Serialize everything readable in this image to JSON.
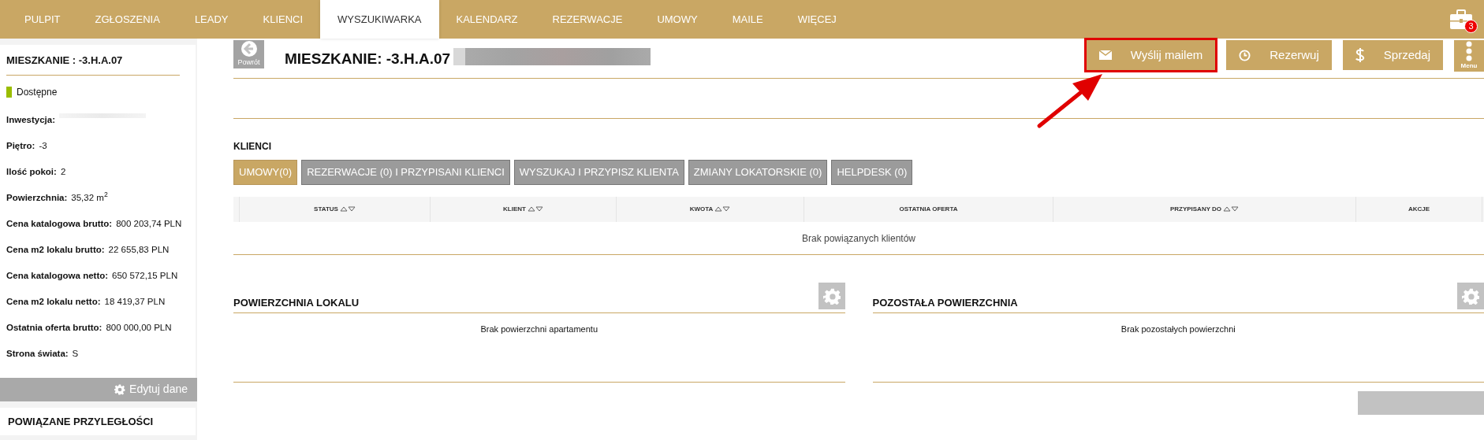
{
  "nav": {
    "items": [
      {
        "label": "PULPIT",
        "selected": false
      },
      {
        "label": "ZGŁOSZENIA",
        "selected": false
      },
      {
        "label": "LEADY",
        "selected": false
      },
      {
        "label": "KLIENCI",
        "selected": false
      },
      {
        "label": "WYSZUKIWARKA",
        "selected": true
      },
      {
        "label": "KALENDARZ",
        "selected": false
      },
      {
        "label": "REZERWACJE",
        "selected": false
      },
      {
        "label": "UMOWY",
        "selected": false
      },
      {
        "label": "MAILE",
        "selected": false
      },
      {
        "label": "WIĘCEJ",
        "selected": false
      }
    ],
    "notifications": "3"
  },
  "sidebar": {
    "title": "MIESZKANIE : -3.H.A.07",
    "status": {
      "label": "Dostępne",
      "color": "#9abd00"
    },
    "fields": [
      {
        "kind": "redacted",
        "label": "Inwestycja:"
      },
      {
        "kind": "text",
        "label": "Piętro:",
        "value": "-3"
      },
      {
        "kind": "text",
        "label": "Ilość pokoi:",
        "value": "2"
      },
      {
        "kind": "text",
        "label": "Powierzchnia:",
        "value": "35,32 m$^{2}$"
      },
      {
        "kind": "text",
        "label": "Cena katalogowa brutto:",
        "value": "800 203,74 PLN"
      },
      {
        "kind": "text",
        "label": "Cena m2 lokalu brutto:",
        "value": "22 655,83 PLN"
      },
      {
        "kind": "text",
        "label": "Cena katalogowa netto:",
        "value": "650 572,15 PLN"
      },
      {
        "kind": "text",
        "label": "Cena m2 lokalu netto:",
        "value": "18 419,37 PLN"
      },
      {
        "kind": "text",
        "label": "Ostatnia oferta brutto:",
        "value": "800 000,00 PLN"
      },
      {
        "kind": "text",
        "label": "Strona świata:",
        "value": "S"
      }
    ],
    "edit_button": "Edytuj dane",
    "related_title": "POWIĄZANE PRZYLEGŁOŚCI"
  },
  "header": {
    "back_label": "Powrót",
    "title": "MIESZKANIE: -3.H.A.07",
    "title_redacted": true,
    "actions": [
      {
        "label": "Wyślij mailem",
        "highlighted": true
      },
      {
        "label": "Rezerwuj",
        "highlighted": false
      },
      {
        "label": "Sprzedaj",
        "highlighted": false
      }
    ],
    "menu_label": "Menu"
  },
  "annotation": {
    "kind": "arrow"
  },
  "clients": {
    "title": "KLIENCI",
    "tabs": [
      {
        "label": "UMOWY(0)",
        "selected": true
      },
      {
        "label": "REZERWACJE (0) I PRZYPISANI KLIENCI",
        "selected": false
      },
      {
        "label": "WYSZUKAJ I PRZYPISZ KLIENTA",
        "selected": false
      },
      {
        "label": "ZMIANY LOKATORSKIE (0)",
        "selected": false
      },
      {
        "label": "HELPDESK (0)",
        "selected": false
      }
    ],
    "columns": [
      {
        "label": "STATUS",
        "sortable": true
      },
      {
        "label": "KLIENT",
        "sortable": true
      },
      {
        "label": "KWOTA",
        "sortable": true
      },
      {
        "label": "OSTATNIA OFERTA",
        "sortable": false
      },
      {
        "label": "PRZYPISANY DO",
        "sortable": true
      },
      {
        "label": "AKCJE",
        "sortable": false
      }
    ],
    "empty": "Brak powiązanych klientów"
  },
  "surfaces": [
    {
      "title": "POWIERZCHNIA LOKALU",
      "empty": "Brak powierzchni apartamentu"
    },
    {
      "title": "POZOSTAŁA POWIERZCHNIA",
      "empty": "Brak pozostałych powierzchni"
    }
  ],
  "bottom_button": {
    "kind": "partial"
  }
}
